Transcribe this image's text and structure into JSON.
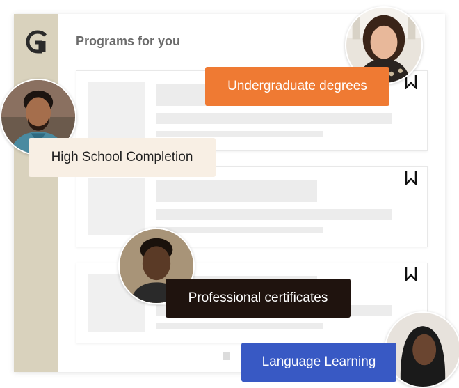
{
  "panel": {
    "heading": "Programs for you",
    "logo_icon": "g-logo-icon",
    "cards": [
      {
        "bookmark_icon": "bookmark-icon"
      },
      {
        "bookmark_icon": "bookmark-icon"
      },
      {
        "bookmark_icon": "bookmark-icon"
      }
    ]
  },
  "chips": {
    "undergraduate": "Undergraduate degrees",
    "high_school": "High School Completion",
    "professional": "Professional certificates",
    "language": "Language Learning"
  },
  "colors": {
    "rail": "#d9d2bd",
    "orange": "#ef7a33",
    "cream": "#f8efe4",
    "dark": "#1f130e",
    "blue": "#3859c4"
  }
}
